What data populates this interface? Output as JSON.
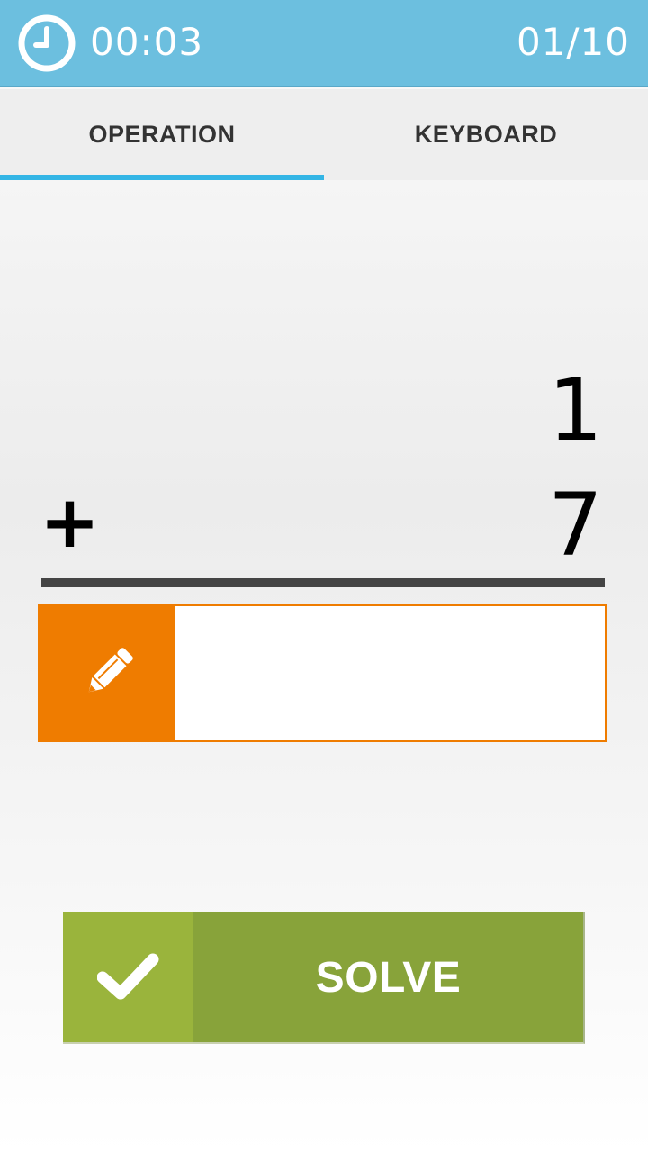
{
  "header": {
    "timer": "00:03",
    "counter": "01/10",
    "icon": "clock-icon",
    "color": "#6cbfdf"
  },
  "tabs": [
    {
      "label": "OPERATION",
      "selected": true
    },
    {
      "label": "KEYBOARD",
      "selected": false
    }
  ],
  "problem": {
    "operand1": "1",
    "operator": "+",
    "operand2": "7"
  },
  "answer": {
    "value": "",
    "placeholder": "",
    "icon": "pencil-icon",
    "accent": "#ef7c00"
  },
  "solve": {
    "label": "SOLVE",
    "icon": "check-icon",
    "color": "#88a33a"
  }
}
